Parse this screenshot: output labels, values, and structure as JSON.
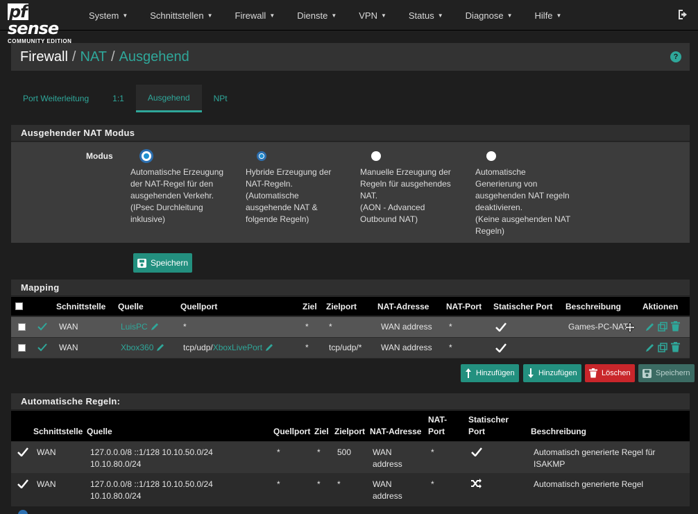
{
  "brand": {
    "logo": "sense",
    "logo_prefix": "pf",
    "edition": "COMMUNITY EDITION"
  },
  "menu": [
    {
      "label": "System"
    },
    {
      "label": "Schnittstellen"
    },
    {
      "label": "Firewall"
    },
    {
      "label": "Dienste"
    },
    {
      "label": "VPN"
    },
    {
      "label": "Status"
    },
    {
      "label": "Diagnose"
    },
    {
      "label": "Hilfe"
    }
  ],
  "breadcrumb": {
    "part1": "Firewall",
    "sep": "/",
    "part2": "NAT",
    "part3": "Ausgehend"
  },
  "tabs": [
    {
      "label": "Port Weiterleitung"
    },
    {
      "label": "1:1"
    },
    {
      "label": "Ausgehend"
    },
    {
      "label": "NPt"
    }
  ],
  "mode_panel": {
    "title": "Ausgehender NAT Modus",
    "label": "Modus",
    "options": [
      {
        "text": "Automatische Erzeugung\nder NAT-Regel für den\nausgehenden Verkehr.\n(IPsec Durchleitung\ninklusive)"
      },
      {
        "text": "Hybride Erzeugung der\nNAT-Regeln.\n(Automatische\nausgehende NAT &\nfolgende Regeln)"
      },
      {
        "text": "Manuelle Erzeugung der\nRegeln für ausgehendes\nNAT.\n(AON - Advanced\nOutbound NAT)"
      },
      {
        "text": "Automatische\nGenerierung von\nausgehenden NAT regeln\ndeaktivieren.\n(Keine ausgehenden NAT\nRegeln)"
      }
    ],
    "save_label": "Speichern"
  },
  "mapping": {
    "title": "Mapping",
    "headers": {
      "iface": "Schnittstelle",
      "source": "Quelle",
      "src_port": "Quellport",
      "dest": "Ziel",
      "dest_port": "Zielport",
      "nat_addr": "NAT-Adresse",
      "nat_port": "NAT-Port",
      "static_port": "Statischer Port",
      "desc": "Beschreibung",
      "actions": "Aktionen"
    },
    "rows": [
      {
        "iface": "WAN",
        "source": "LuisPC",
        "src_port_prefix": "*",
        "src_port_link": "",
        "dest": "*",
        "dest_port": "*",
        "nat_addr": "WAN address",
        "nat_port": "*",
        "desc": "Games-PC-NAT"
      },
      {
        "iface": "WAN",
        "source": "Xbox360",
        "src_port_prefix": "tcp/udp/",
        "src_port_link": "XboxLivePort",
        "dest": "*",
        "dest_port": "tcp/udp/*",
        "nat_addr": "WAN address",
        "nat_port": "*",
        "desc": ""
      }
    ],
    "buttons": {
      "add_top": "Hinzufügen",
      "add_bottom": "Hinzufügen",
      "delete": "Löschen",
      "save": "Speichern"
    }
  },
  "auto_rules": {
    "title": "Automatische Regeln:",
    "headers": {
      "iface": "Schnittstelle",
      "source": "Quelle",
      "src_port": "Quellport",
      "dest": "Ziel",
      "dest_port": "Zielport",
      "nat_addr": "NAT-Adresse",
      "nat_port_1": "NAT-",
      "nat_port_2": "Port",
      "static_port_1": "Statischer",
      "static_port_2": "Port",
      "desc": "Beschreibung"
    },
    "rows": [
      {
        "iface": "WAN",
        "source_1": "127.0.0.0/8 ::1/128 10.10.50.0/24",
        "source_2": "10.10.80.0/24",
        "src_port": "*",
        "dest": "*",
        "dest_port": "500",
        "nat_addr_1": "WAN",
        "nat_addr_2": "address",
        "nat_port": "*",
        "desc_1": "Automatisch generierte Regel für",
        "desc_2": "ISAKMP"
      },
      {
        "iface": "WAN",
        "source_1": "127.0.0.0/8 ::1/128 10.10.50.0/24",
        "source_2": "10.10.80.0/24",
        "src_port": "*",
        "dest": "*",
        "dest_port": "*",
        "nat_addr_1": "WAN",
        "nat_addr_2": "address",
        "nat_port": "*",
        "desc_1": "Automatisch generierte Regel",
        "desc_2": ""
      }
    ]
  },
  "colors": {
    "accent": "#2fa79a",
    "danger": "#c9262b",
    "navbar": "#212121"
  }
}
